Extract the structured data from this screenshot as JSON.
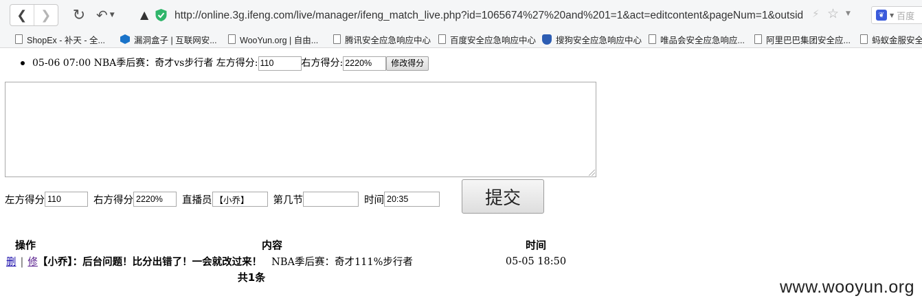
{
  "browser": {
    "url": "http://online.3g.ifeng.com/live/manager/ifeng_match_live.php?id=1065674%27%20and%201=1&act=editcontent&pageNum=1&outsid",
    "search_placeholder": "百度",
    "bookmarks": [
      "ShopEx - 补天 - 全...",
      "漏洞盒子 | 互联网安...",
      "WooYun.org | 自由...",
      "腾讯安全应急响应中心",
      "百度安全应急响应中心",
      "搜狗安全应急响应中心",
      "唯品会安全应急响应...",
      "阿里巴巴集团安全应...",
      "蚂蚁金服安全"
    ]
  },
  "match_item": {
    "summary": "05-06 07:00 NBA季后赛：奇才vs步行者 左方得分:",
    "left_score": "110",
    "right_label": "右方得分:",
    "right_score": "2220%",
    "edit_button": "修改得分"
  },
  "form": {
    "left_score_label": "左方得分",
    "left_score": "110",
    "right_score_label": "右方得分",
    "right_score": "2220%",
    "host_label": "直播员",
    "host": "【小乔】",
    "period_label": "第几节",
    "period": "",
    "time_label": "时间",
    "time": "20:35",
    "submit": "提交"
  },
  "table": {
    "headers": [
      "操作",
      "内容",
      "时间"
    ],
    "rows": [
      {
        "delete": "删",
        "sep": "|",
        "edit": "修",
        "message": "【小乔】：后台问题！比分出错了！一会就改过来！",
        "match": "NBA季后赛：奇才111%步行者",
        "time": "05-05 18:50"
      }
    ],
    "total": "共1条"
  },
  "watermark": "www.wooyun.org"
}
